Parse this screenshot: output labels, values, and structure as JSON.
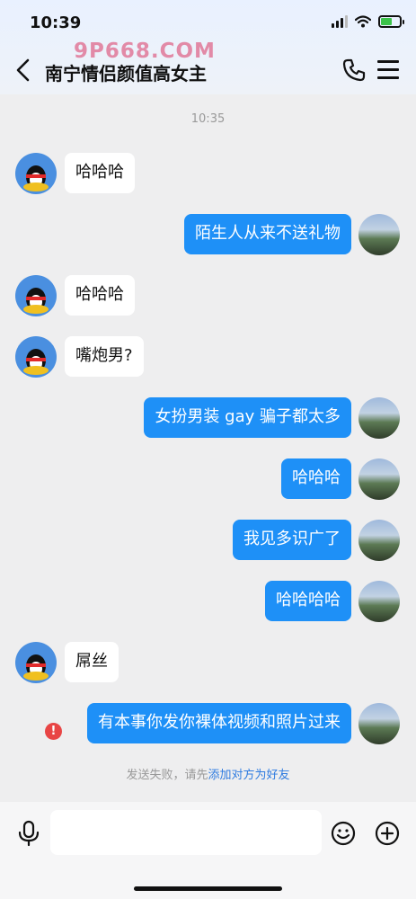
{
  "status_bar": {
    "time": "10:39",
    "battery_level": 0.55,
    "battery_color": "#3cc34a"
  },
  "watermark": {
    "text": "9P668.COM",
    "color": "#e28aa7"
  },
  "nav": {
    "title": "南宁情侣颜值高女主",
    "back_icon": "chevron-left-icon",
    "call_icon": "phone-icon",
    "menu_icon": "hamburger-menu-icon"
  },
  "chat": {
    "timestamp": "10:35",
    "messages": [
      {
        "side": "in",
        "text": "哈哈哈"
      },
      {
        "side": "out",
        "text": "陌生人从来不送礼物"
      },
      {
        "side": "in",
        "text": "哈哈哈"
      },
      {
        "side": "in",
        "text": "嘴炮男?"
      },
      {
        "side": "out",
        "text": "女扮男装  gay  骗子都太多"
      },
      {
        "side": "out",
        "text": "哈哈哈"
      },
      {
        "side": "out",
        "text": "我见多识广了"
      },
      {
        "side": "out",
        "text": "哈哈哈哈"
      },
      {
        "side": "in",
        "text": "屌丝"
      },
      {
        "side": "out",
        "text": "有本事你发你裸体视频和照片过来",
        "failed": true
      }
    ],
    "error_mark": "!",
    "send_failed": {
      "prefix": "发送失败，请先",
      "link": "添加对方为好友"
    }
  },
  "input_bar": {
    "text_value": "",
    "voice_icon": "microphone-icon",
    "emoji_icon": "smiley-icon",
    "more_icon": "plus-circle-icon"
  },
  "colors": {
    "outgoing_bubble": "#1e90f7",
    "incoming_bubble": "#ffffff",
    "chat_background": "#eeeeef",
    "error": "#e84545",
    "link": "#2e7be0"
  }
}
